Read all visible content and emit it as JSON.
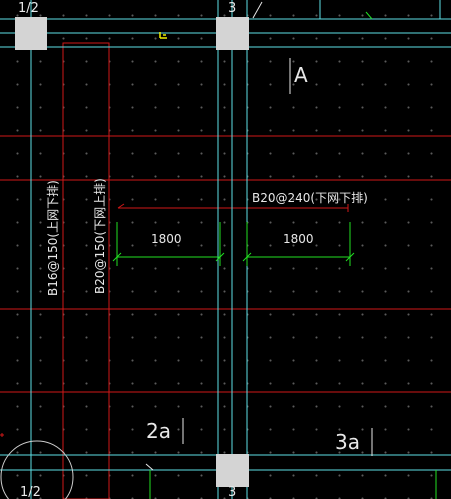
{
  "axis_labels": {
    "top_left": "1/2",
    "top_right": "3",
    "bottom_left": "1/2",
    "bottom_right": "3"
  },
  "grid_labels": {
    "a": "A",
    "2a": "2a",
    "3a": "3a"
  },
  "rebar_labels": {
    "vertical_left": "B16@150(上网下排)",
    "vertical_right": "B20@150(下网上排)",
    "horizontal": "B20@240(下网下排)"
  },
  "dimensions": {
    "left": "1800",
    "right": "1800"
  },
  "colors": {
    "background": "#000000",
    "beam_cyan": "#5ee0e6",
    "axis_red": "#d01818",
    "dimension_green": "#22e022",
    "column_fill": "#d4d4d4",
    "text": "#e8e8e8",
    "snap_marker": "#f0f000"
  }
}
